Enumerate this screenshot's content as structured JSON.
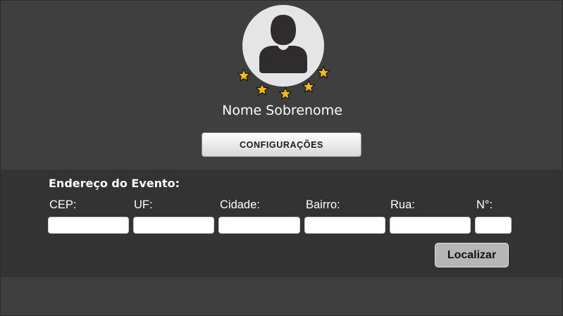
{
  "profile": {
    "name": "Nome Sobrenome",
    "avatar_icon": "user-avatar-icon",
    "rating_icon": "star-icon",
    "star_color": "#f6b90e"
  },
  "header": {
    "config_button": "CONFIGURAÇÕES"
  },
  "address": {
    "title": "Endereço do Evento:",
    "fields": [
      {
        "label": "CEP:",
        "value": "",
        "placeholder": ""
      },
      {
        "label": "UF:",
        "value": "",
        "placeholder": ""
      },
      {
        "label": "Cidade:",
        "value": "",
        "placeholder": ""
      },
      {
        "label": "Bairro:",
        "value": "",
        "placeholder": ""
      },
      {
        "label": "Rua:",
        "value": "",
        "placeholder": ""
      },
      {
        "label": "N°:",
        "value": "",
        "placeholder": ""
      }
    ],
    "search_button": "Localizar"
  },
  "colors": {
    "background": "#403f40",
    "panel": "#343334",
    "accent_star": "#f6b90e"
  }
}
